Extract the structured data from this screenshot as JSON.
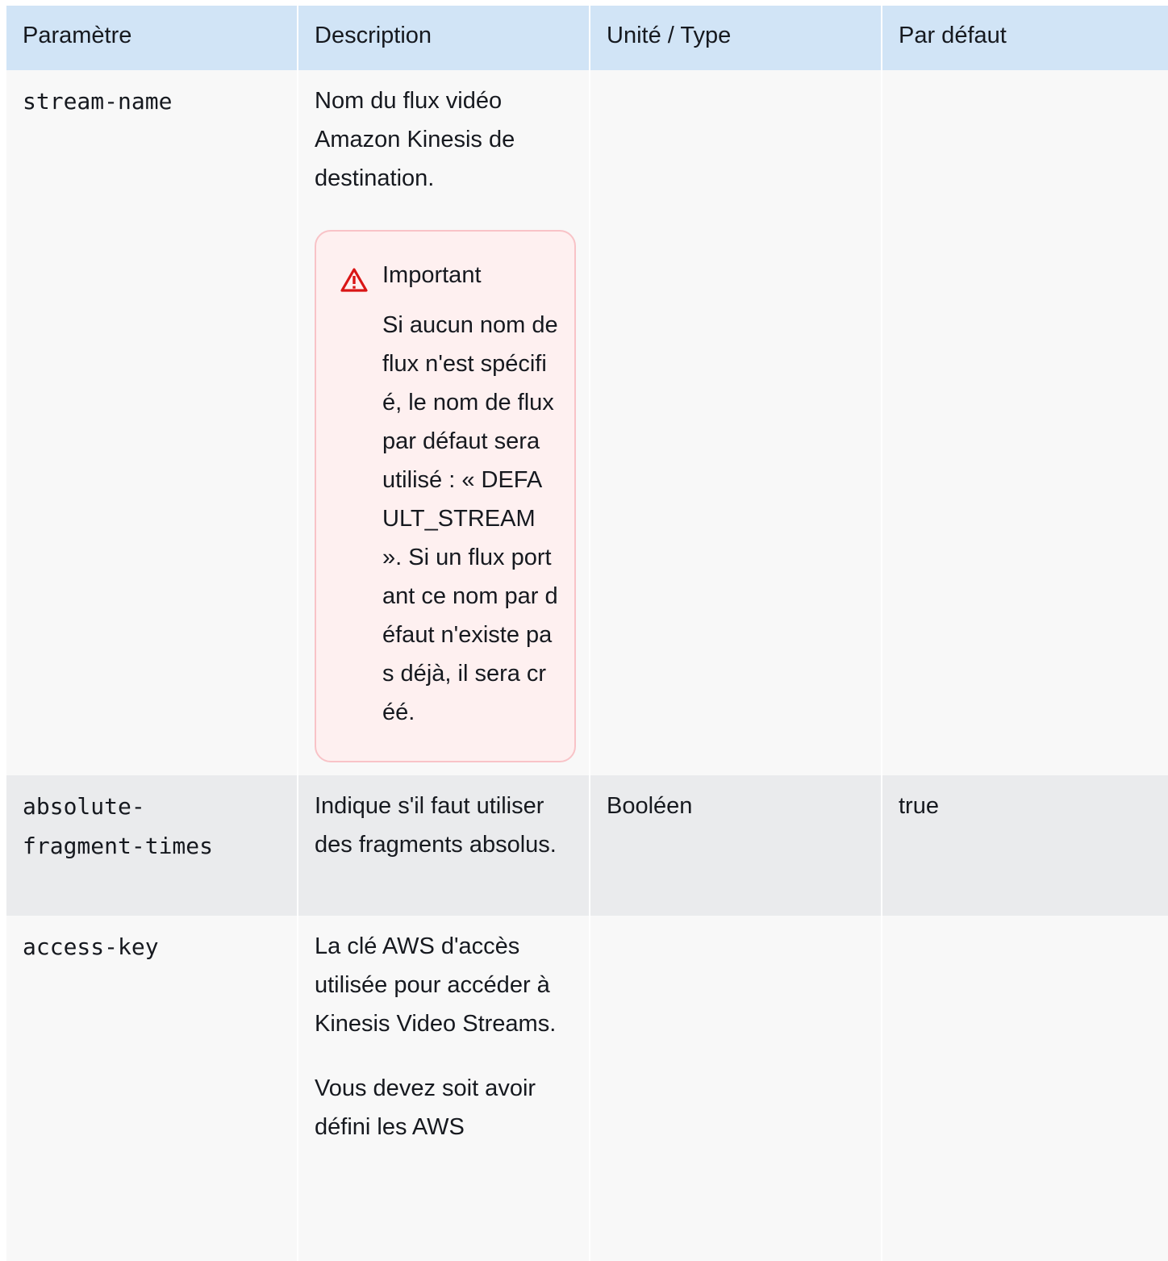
{
  "table": {
    "headers": [
      "Paramètre",
      "Description",
      "Unité / Type",
      "Par défaut"
    ],
    "rows": [
      {
        "param": "stream-name",
        "description": "Nom du flux vidéo Amazon Kinesis de destination.",
        "alert": {
          "title": "Important",
          "text": "Si aucun nom de flux n'est spécifié, le nom de flux par défaut sera utilisé : « DEFAULT_STREAM ». Si un flux portant ce nom par défaut n'existe pas déjà, il sera créé."
        },
        "type": "",
        "default": ""
      },
      {
        "param": "absolute-fragment-times",
        "description": "Indique s'il faut utiliser des fragments absolus.",
        "type": "Booléen",
        "default": "true"
      },
      {
        "param": "access-key",
        "description": "La clé AWS d'accès utilisée pour accéder à Kinesis Video Streams.",
        "description_2": "Vous devez soit avoir défini les AWS",
        "type": "",
        "default": ""
      }
    ]
  },
  "icons": {
    "alert_icon": "warning-triangle-icon",
    "alert_color": "#d91515"
  }
}
